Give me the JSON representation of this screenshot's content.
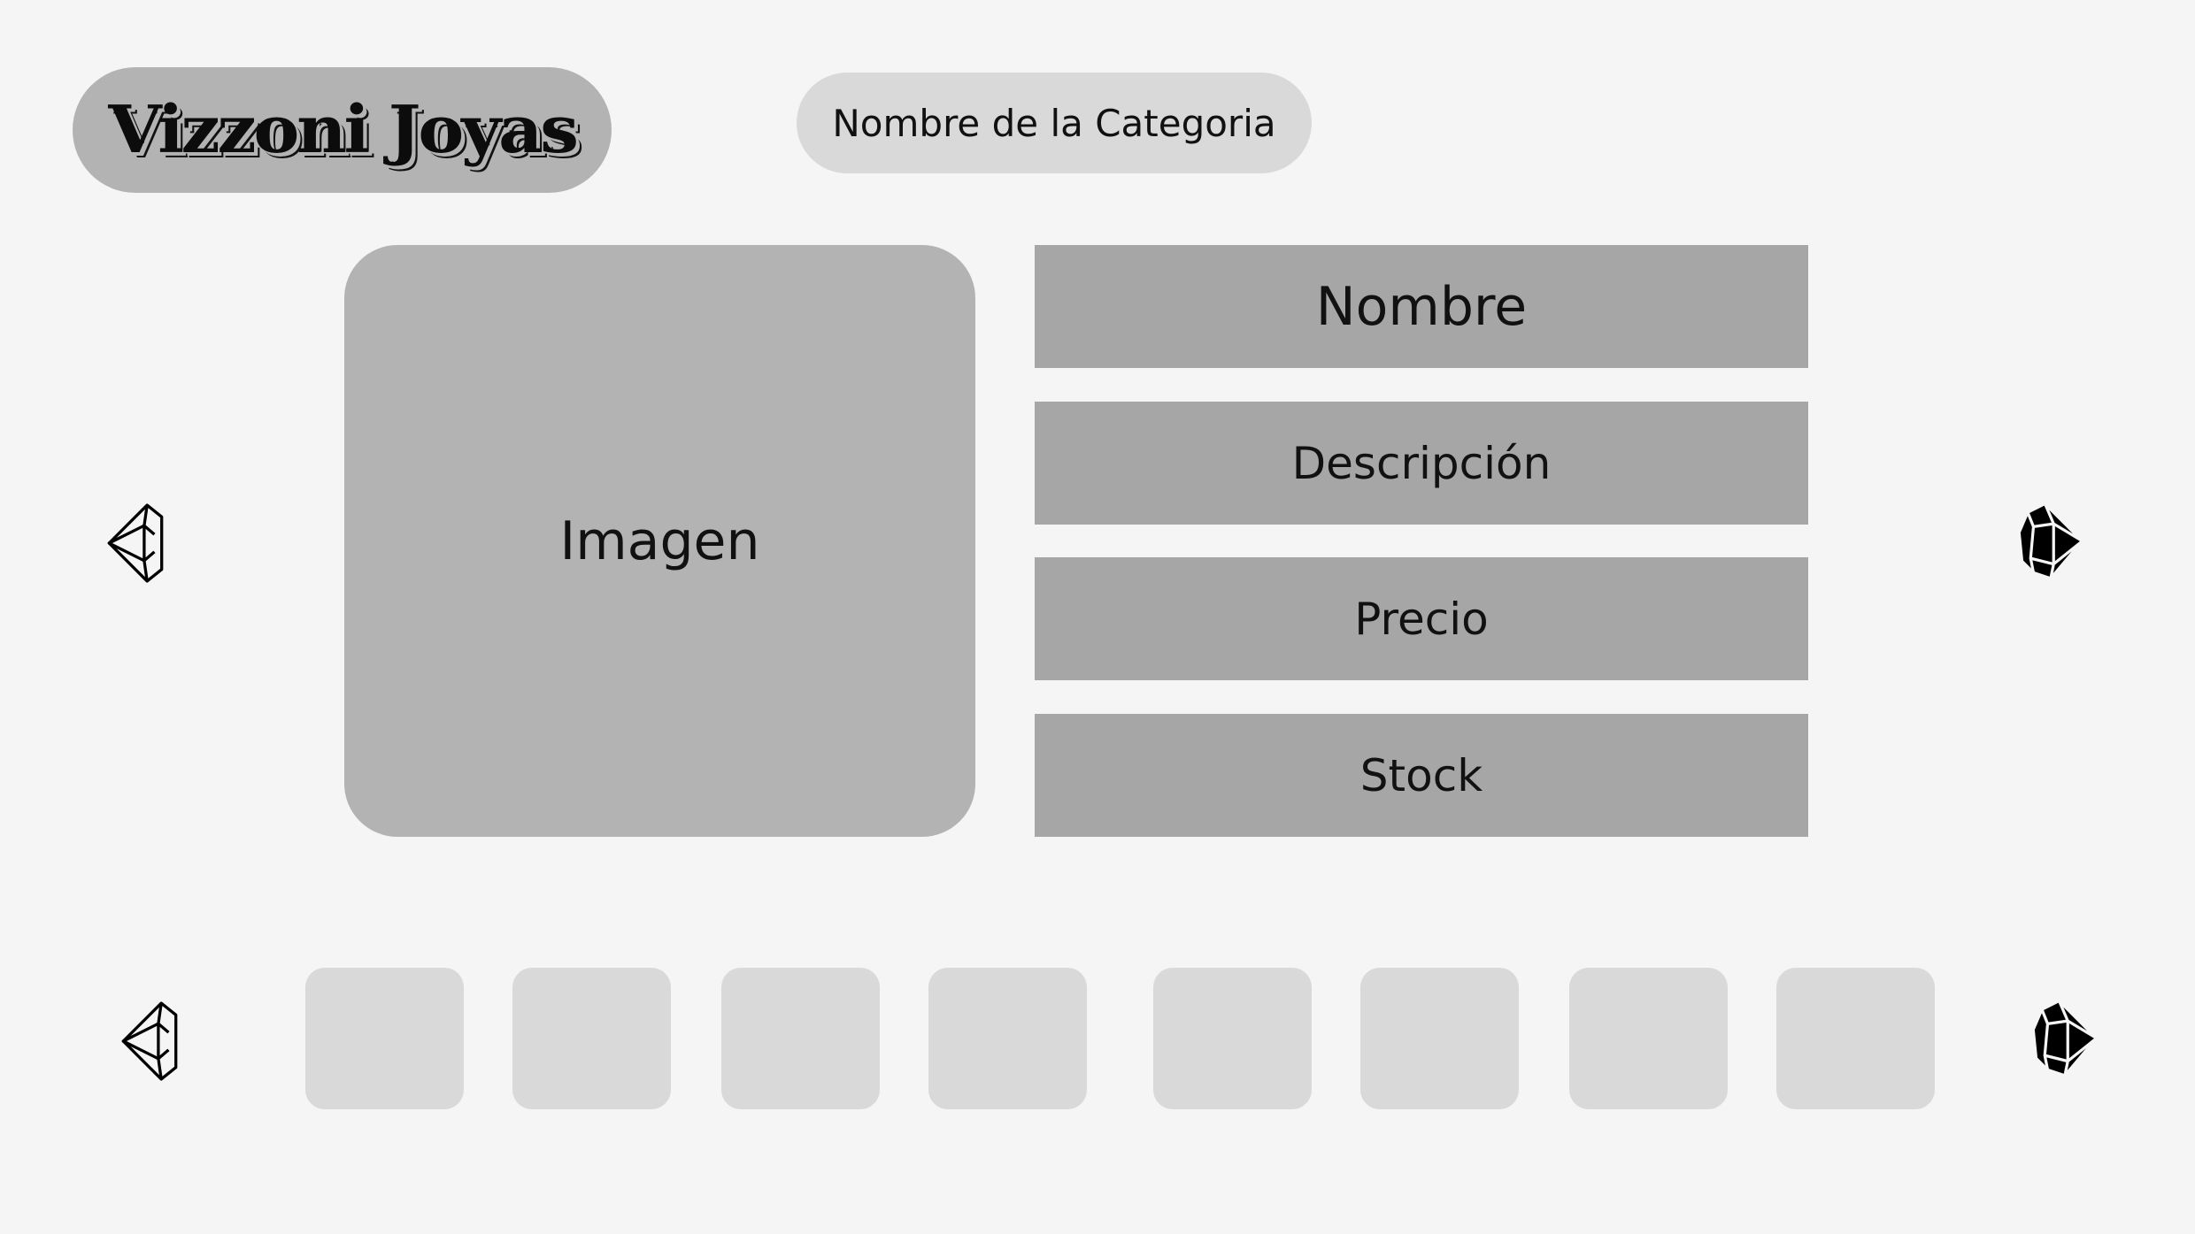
{
  "header": {
    "logo_text": "Vizzoni Joyas",
    "category_label": "Nombre de la Categoria"
  },
  "product": {
    "image_label": "Imagen",
    "fields": [
      {
        "label": "Nombre"
      },
      {
        "label": "Descripción"
      },
      {
        "label": "Precio"
      },
      {
        "label": "Stock"
      }
    ]
  },
  "navigation": {
    "prev_icon": "diamond-outline-left-icon",
    "next_icon": "diamond-solid-right-icon"
  },
  "thumbnails": {
    "count": 8
  },
  "colors": {
    "background": "#f5f5f5",
    "logo_pill": "#b3b3b3",
    "category_pill": "#d9d9d9",
    "image_box": "#b3b3b3",
    "field_box": "#a6a6a6",
    "thumbnail": "#d9d9d9"
  }
}
